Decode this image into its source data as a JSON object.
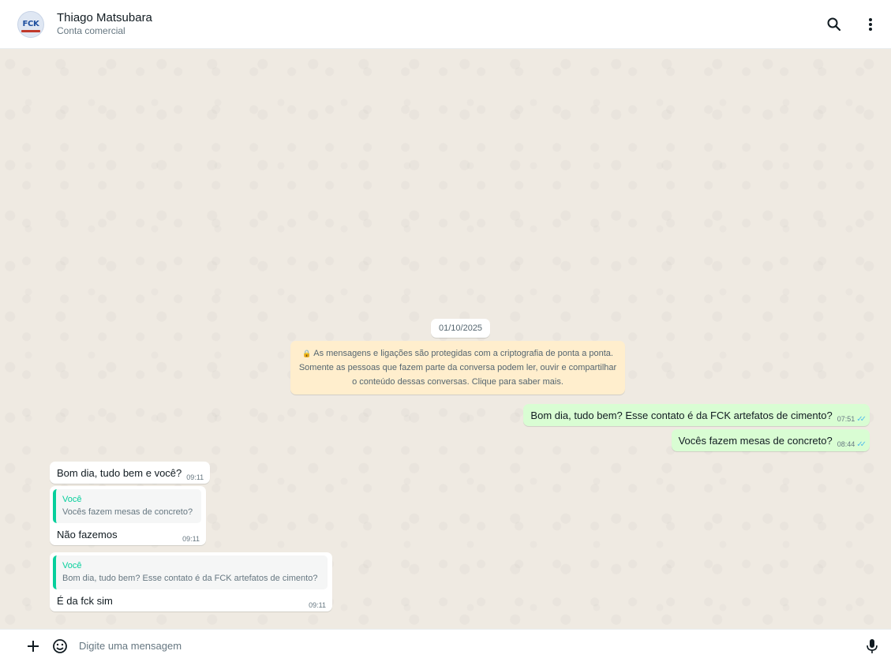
{
  "header": {
    "avatar_text": "FCK",
    "contact_name": "Thiago Matsubara",
    "contact_subtitle": "Conta comercial",
    "icons": [
      "search-icon",
      "menu-icon"
    ]
  },
  "chat": {
    "date_divider": "01/10/2025",
    "encryption_notice": {
      "line1": "As mensagens e ligações são protegidas com a criptografia de ponta a ponta.",
      "line2": "Somente as pessoas que fazem parte da conversa podem ler, ouvir e compartilhar",
      "line3": "o conteúdo dessas conversas. Clique para saber mais."
    },
    "outgoing": [
      {
        "text": "Bom dia, tudo bem? Esse contato é da FCK artefatos de cimento?",
        "time": "07:51",
        "status": "read"
      },
      {
        "text": "Vocês fazem mesas de concreto?",
        "time": "08:44",
        "status": "read"
      }
    ],
    "incoming": [
      {
        "text": "Bom dia, tudo bem e você?",
        "time": "09:11"
      },
      {
        "quoted_author": "Você",
        "quoted_text": "Vocês fazem mesas de concreto?",
        "text": "Não fazemos",
        "time": "09:11"
      },
      {
        "quoted_author": "Você",
        "quoted_text": "Bom dia, tudo bem? Esse contato é da FCK artefatos de cimento?",
        "text": "É da fck sim",
        "time": "09:11"
      }
    ]
  },
  "composer": {
    "placeholder": "Digite uma mensagem",
    "icons": [
      "plus-icon",
      "sticker-icon",
      "microphone-icon"
    ]
  },
  "colors": {
    "outgoing_bubble": "#d9fdd3",
    "incoming_bubble": "#ffffff",
    "chat_background": "#efeae2",
    "encryption_notice_bg": "#ffeecd",
    "quote_accent": "#06cf9c",
    "read_ticks": "#53bdeb"
  }
}
